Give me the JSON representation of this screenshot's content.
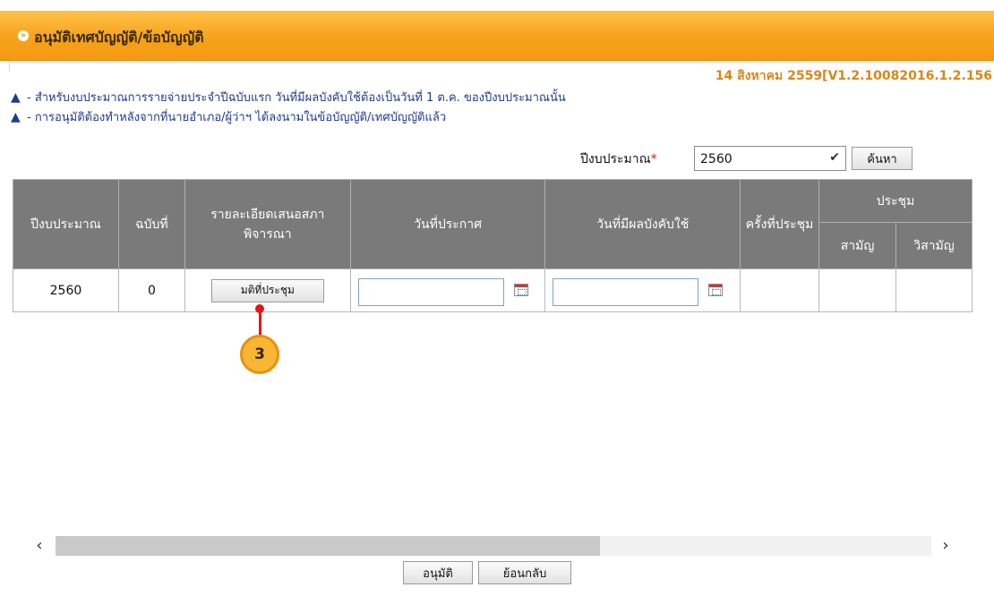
{
  "header": {
    "title": "อนุมัติเทศบัญญัติ/ข้อบัญญัติ",
    "icon": "double-chevron-right-icon"
  },
  "version_text": "14 สิงหาคม 2559[V1.2.10082016.1.2.156",
  "notes": [
    "- สำหรับงบประมาณการรายจ่ายประจำปีฉบับแรก วันที่มีผลบังคับใช้ต้องเป็นวันที่ 1 ต.ค. ของปีงบประมาณนั้น",
    "- การอนุมัติต้องทำหลังจากที่นายอำเภอ/ผู้ว่าฯ ได้ลงนามในข้อบัญญัติ/เทศบัญญัติแล้ว"
  ],
  "filter": {
    "label": "ปีงบประมาณ",
    "required_mark": "*",
    "selected_year": "2560",
    "search_label": "ค้นหา"
  },
  "table": {
    "headers": {
      "year": "ปีงบประมาณ",
      "edition": "ฉบับที่",
      "details": "รายละเอียดเสนอสภาพิจารณา",
      "announce_date": "วันที่ประกาศ",
      "effective_date": "วันที่มีผลบังคับใช้",
      "session_no": "ครั้งที่ประชุม",
      "meeting": "ประชุม",
      "ordinary": "สามัญ",
      "extraordinary": "วิสามัญ"
    },
    "rows": [
      {
        "year": "2560",
        "edition": "0",
        "details_button": "มติที่ประชุม"
      }
    ]
  },
  "annotation": {
    "marker": "3",
    "color": "#e01818"
  },
  "footer": {
    "approve_label": "อนุมัติ",
    "back_label": "ย้อนกลับ"
  },
  "colors": {
    "header_orange": "#f7a21b",
    "note_blue": "#1f3a93",
    "version_orange": "#d8871a",
    "table_header": "#7a7a7a"
  }
}
